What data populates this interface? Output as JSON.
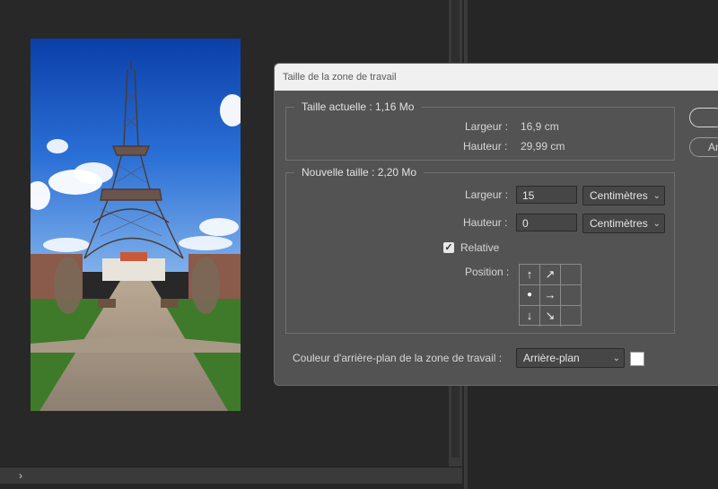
{
  "dialog": {
    "title": "Taille de la zone de travail",
    "current": {
      "legend": "Taille actuelle : 1,16 Mo",
      "width_label": "Largeur :",
      "width_value": "16,9 cm",
      "height_label": "Hauteur :",
      "height_value": "29,99 cm"
    },
    "new_size": {
      "legend": "Nouvelle taille : 2,20 Mo",
      "width_label": "Largeur :",
      "width_value": "15",
      "width_unit": "Centimètres",
      "height_label": "Hauteur :",
      "height_value": "0",
      "height_unit": "Centimètres",
      "relative_label": "Relative",
      "relative_checked": true,
      "position_label": "Position :",
      "anchor_selected": "center"
    },
    "background": {
      "label": "Couleur d'arrière-plan de la zone de travail :",
      "value": "Arrière-plan",
      "swatch_color": "#ffffff"
    },
    "buttons": {
      "ok_label": "",
      "cancel_label": "An"
    }
  },
  "canvas": {
    "image": "eiffel-tower-photo"
  },
  "scrollbar": {
    "arrow": "›"
  }
}
